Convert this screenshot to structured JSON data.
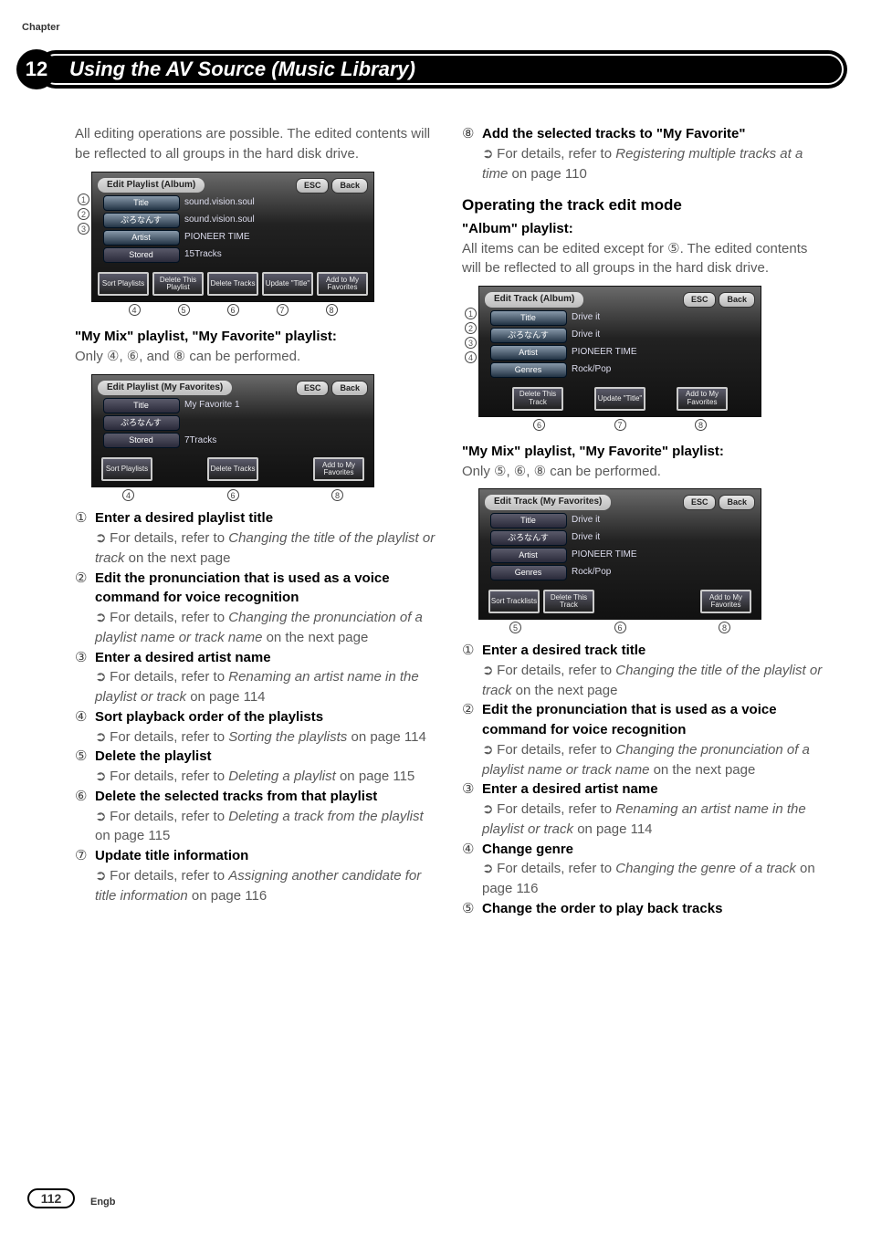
{
  "chapter": {
    "label": "Chapter",
    "number": "12",
    "title": "Using the AV Source (Music Library)"
  },
  "left": {
    "intro": "All editing operations are possible. The edited contents will be reflected to all groups in the hard disk drive.",
    "shot1": {
      "header": "Edit Playlist (Album)",
      "esc": "ESC",
      "back": "Back",
      "rows": [
        {
          "label": "Title",
          "value": "sound.vision.soul"
        },
        {
          "label": "ぷろなんす",
          "value": "sound.vision.soul"
        },
        {
          "label": "Artist",
          "value": "PIONEER TIME"
        },
        {
          "label": "Stored",
          "value": "15Tracks"
        }
      ],
      "btns": [
        "Sort Playlists",
        "Delete This Playlist",
        "Delete Tracks",
        "Update \"Title\"",
        "Add to My Favorites"
      ],
      "side": [
        "1",
        "2",
        "3"
      ],
      "bottom": [
        "4",
        "5",
        "6",
        "7",
        "8"
      ]
    },
    "mymix_h": "\"My Mix\" playlist, \"My Favorite\" playlist:",
    "mymix_p": "Only ④, ⑥, and ⑧ can be performed.",
    "shot2": {
      "header": "Edit Playlist (My Favorites)",
      "esc": "ESC",
      "back": "Back",
      "rows": [
        {
          "label": "Title",
          "value": "My Favorite 1"
        },
        {
          "label": "ぷろなんす",
          "value": ""
        },
        {
          "label": "Stored",
          "value": "7Tracks"
        }
      ],
      "btns": [
        "Sort Playlists",
        "Delete Tracks",
        "Add to My Favorites"
      ],
      "bottom": [
        "4",
        "6",
        "8"
      ]
    },
    "items": [
      {
        "n": "①",
        "t": "Enter a desired playlist title",
        "d1": "For details, refer to ",
        "di": "Changing the title of the playlist or track",
        "d2": " on the next page"
      },
      {
        "n": "②",
        "t": "Edit the pronunciation that is used as a voice command for voice recognition",
        "d1": "For details, refer to ",
        "di": "Changing the pronunciation of a playlist name or track name",
        "d2": " on the next page"
      },
      {
        "n": "③",
        "t": "Enter a desired artist name",
        "d1": "For details, refer to ",
        "di": "Renaming an artist name in the playlist or track",
        "d2": " on page 114"
      },
      {
        "n": "④",
        "t": "Sort playback order of the playlists",
        "d1": "For details, refer to ",
        "di": "Sorting the playlists",
        "d2": " on page 114"
      },
      {
        "n": "⑤",
        "t": "Delete the playlist",
        "d1": "For details, refer to ",
        "di": "Deleting a playlist",
        "d2": " on page 115"
      },
      {
        "n": "⑥",
        "t": "Delete the selected tracks from that playlist",
        "d1": "For details, refer to ",
        "di": "Deleting a track from the playlist",
        "d2": " on page 115"
      },
      {
        "n": "⑦",
        "t": "Update title information",
        "d1": "For details, refer to ",
        "di": "Assigning another candidate for title information",
        "d2": " on page 116"
      }
    ]
  },
  "right": {
    "item8": {
      "n": "⑧",
      "t": "Add the selected tracks to \"My Favorite\"",
      "d1": "For details, refer to ",
      "di": "Registering multiple tracks at a time",
      "d2": " on page 110"
    },
    "h2": "Operating the track edit mode",
    "h3a": "\"Album\" playlist:",
    "pa": "All items can be edited except for ⑤. The edited contents will be reflected to all groups in the hard disk drive.",
    "shot3": {
      "header": "Edit Track (Album)",
      "esc": "ESC",
      "back": "Back",
      "rows": [
        {
          "label": "Title",
          "value": "Drive it"
        },
        {
          "label": "ぷろなんす",
          "value": "Drive it"
        },
        {
          "label": "Artist",
          "value": "PIONEER TIME"
        },
        {
          "label": "Genres",
          "value": "Rock/Pop"
        }
      ],
      "btns": [
        "Delete This Track",
        "Update \"Title\"",
        "Add to My Favorites"
      ],
      "side": [
        "1",
        "2",
        "3",
        "4"
      ],
      "bottom": [
        "6",
        "7",
        "8"
      ]
    },
    "mymix_h": "\"My Mix\" playlist, \"My Favorite\" playlist:",
    "mymix_p": "Only ⑤, ⑥, ⑧ can be performed.",
    "shot4": {
      "header": "Edit Track (My Favorites)",
      "esc": "ESC",
      "back": "Back",
      "rows": [
        {
          "label": "Title",
          "value": "Drive it"
        },
        {
          "label": "ぷろなんす",
          "value": "Drive it"
        },
        {
          "label": "Artist",
          "value": "PIONEER TIME"
        },
        {
          "label": "Genres",
          "value": "Rock/Pop"
        }
      ],
      "btns": [
        "Sort Tracklists",
        "Delete This Track",
        "Add to My Favorites"
      ],
      "bottom": [
        "5",
        "6",
        "8"
      ]
    },
    "items": [
      {
        "n": "①",
        "t": "Enter a desired track title",
        "d1": "For details, refer to ",
        "di": "Changing the title of the playlist or track",
        "d2": " on the next page"
      },
      {
        "n": "②",
        "t": "Edit the pronunciation that is used as a voice command for voice recognition",
        "d1": "For details, refer to ",
        "di": "Changing the pronunciation of a playlist name or track name",
        "d2": " on the next page"
      },
      {
        "n": "③",
        "t": "Enter a desired artist name",
        "d1": "For details, refer to ",
        "di": "Renaming an artist name in the playlist or track",
        "d2": " on page 114"
      },
      {
        "n": "④",
        "t": "Change genre",
        "d1": "For details, refer to ",
        "di": "Changing the genre of a track",
        "d2": " on page 116"
      },
      {
        "n": "⑤",
        "t": "Change the order to play back tracks",
        "d1": "",
        "di": "",
        "d2": ""
      }
    ]
  },
  "footer": {
    "page": "112",
    "lang": "Engb"
  },
  "glyph_arrow": "➲"
}
